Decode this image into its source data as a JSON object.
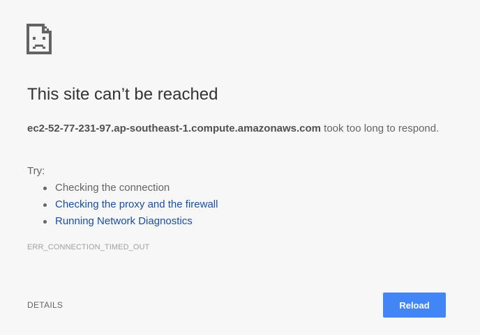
{
  "icon": {
    "name": "sad-page-icon"
  },
  "main": {
    "heading": "This site can’t be reached",
    "host": "ec2-52-77-231-97.ap-southeast-1.compute.amazonaws.com",
    "message_suffix": " took too long to respond.",
    "try_label": "Try:",
    "suggestions": [
      {
        "label": "Checking the connection"
      },
      {
        "label": "Checking the proxy and the firewall"
      },
      {
        "label": "Running Network Diagnostics"
      }
    ],
    "error_code": "ERR_CONNECTION_TIMED_OUT"
  },
  "footer": {
    "details_label": "DETAILS",
    "reload_label": "Reload"
  },
  "colors": {
    "background": "#f7f7f7",
    "heading": "#333333",
    "link": "#1a4ea3",
    "button": "#4285f4"
  }
}
